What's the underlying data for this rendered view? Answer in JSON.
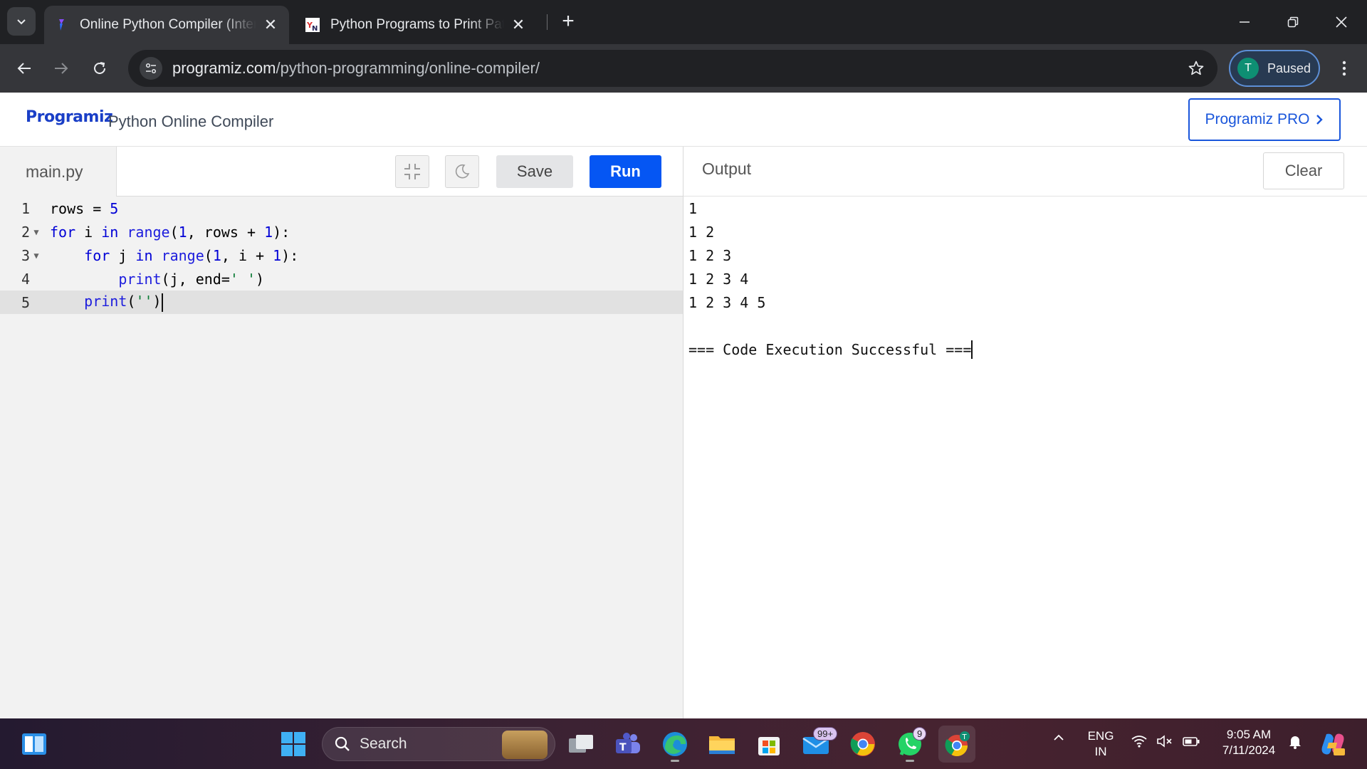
{
  "browser": {
    "tabs": [
      {
        "title": "Online Python Compiler (Interpreter)",
        "active": true
      },
      {
        "title": "Python Programs to Print Pattern",
        "active": false
      }
    ],
    "url_host": "programiz.com",
    "url_path": "/python-programming/online-compiler/",
    "profile_initial": "T",
    "profile_status": "Paused"
  },
  "header": {
    "logo_text": "Programiz",
    "title": "Python Online Compiler",
    "pro_button": "Programiz PRO"
  },
  "editor": {
    "file_name": "main.py",
    "save_label": "Save",
    "run_label": "Run",
    "line_numbers": [
      "1",
      "2",
      "3",
      "4",
      "5"
    ],
    "code_lines": [
      "rows = 5",
      "for i in range(1, rows + 1):",
      "    for j in range(1, i + 1):",
      "        print(j, end=' ')",
      "    print('')"
    ],
    "active_line": 5
  },
  "output": {
    "title": "Output",
    "clear_label": "Clear",
    "lines": [
      "1",
      "1 2",
      "1 2 3",
      "1 2 3 4",
      "1 2 3 4 5",
      "",
      "=== Code Execution Successful ==="
    ]
  },
  "taskbar": {
    "search_placeholder": "Search",
    "mail_badge": "99+",
    "whatsapp_badge": "9",
    "chrome_avatar": "T",
    "language_top": "ENG",
    "language_bottom": "IN",
    "time": "9:05 AM",
    "date": "7/11/2024"
  }
}
